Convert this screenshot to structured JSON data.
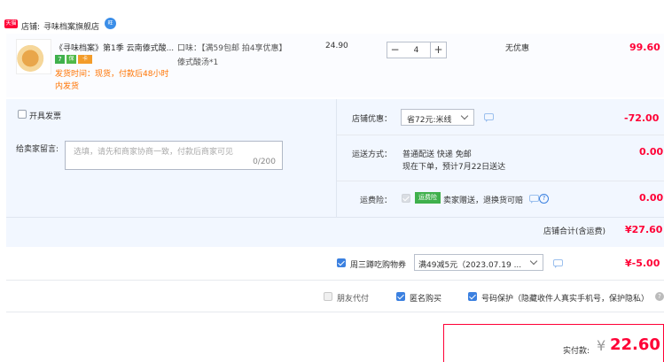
{
  "shop": {
    "badge": "天猫",
    "label": "店铺:",
    "name": "寻味档案旗舰店",
    "chat_badge": "旺"
  },
  "product": {
    "title": "《寻味档案》第1季 云南傣式酸...",
    "tags": [
      "7",
      "保",
      "卡"
    ],
    "ship_note_1": "发货时间：现货，付款后48小时",
    "ship_note_2": "内发货",
    "sku_line_1": "口味：【满59包邮 拍4享优惠】",
    "sku_line_2": "傣式酸汤*1",
    "unit_price": "24.90",
    "quantity": "4",
    "minus": "−",
    "plus": "+",
    "promo": "无优惠",
    "subtotal": "99.60"
  },
  "invoice": {
    "label": "开具发票"
  },
  "message": {
    "label": "给卖家留言:",
    "placeholder": "选填，请先和商家协商一致，付款后商家可见",
    "counter": "0/200"
  },
  "shop_discount": {
    "label": "店铺优惠：",
    "selected": "省72元:米线",
    "amount": "-72.00"
  },
  "delivery": {
    "label": "运送方式：",
    "line_1": "普通配送 快递 免邮",
    "line_2": "现在下单，预计7月22日送达",
    "amount": "0.00"
  },
  "insurance": {
    "label": "运费险：",
    "badge": "运费险",
    "text": "卖家赠送，退换货可赔",
    "amount": "0.00"
  },
  "shop_total": {
    "label": "店铺合计(含运费)",
    "amount": "¥27.60"
  },
  "coupon": {
    "label": "周三蹲吃购物券",
    "selected": "满49减5元（2023.07.19 ...",
    "amount": "¥-5.00"
  },
  "options": [
    {
      "label": "朋友代付",
      "checked": false
    },
    {
      "label": "匿名购买",
      "checked": true
    },
    {
      "label": "号码保护（隐藏收件人真实手机号，保护隐私）",
      "checked": true
    }
  ],
  "payment": {
    "label": "实付款:",
    "currency": "¥",
    "amount": "22.60"
  }
}
